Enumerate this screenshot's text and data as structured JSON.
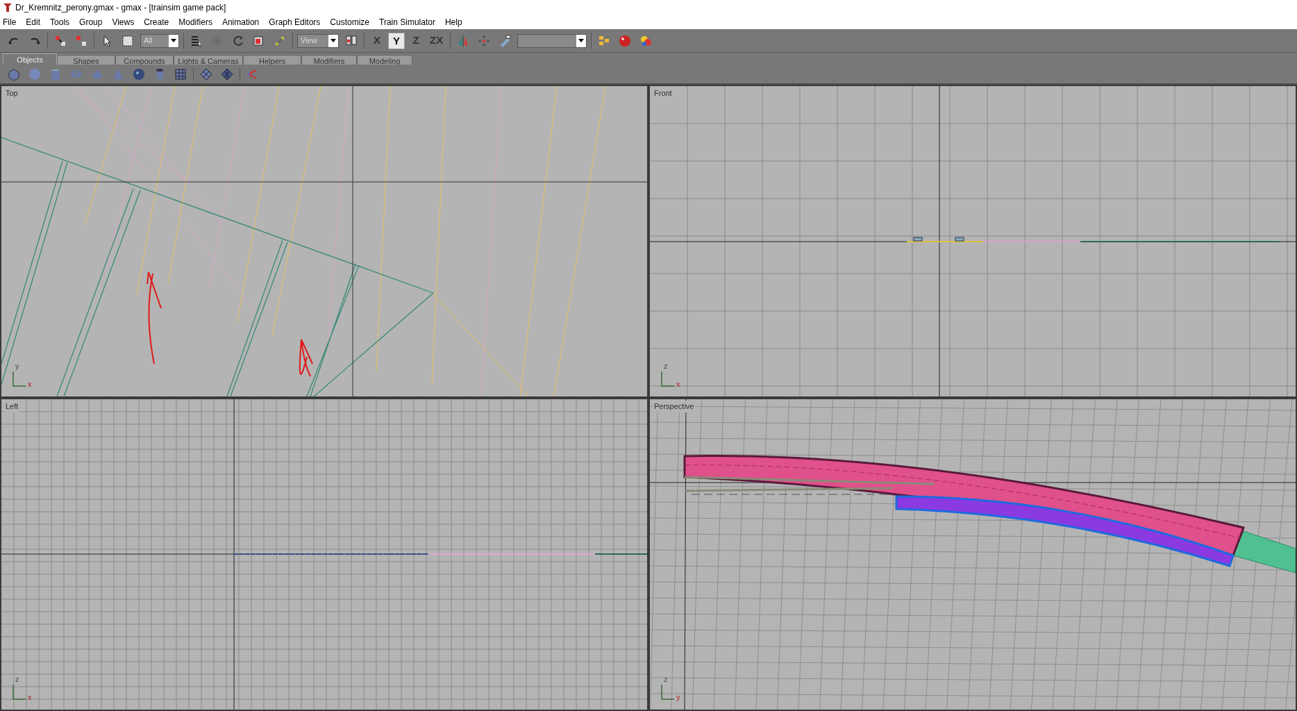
{
  "window": {
    "title": "Dr_Kremnitz_perony.gmax - gmax - [trainsim game pack]"
  },
  "menu": [
    "File",
    "Edit",
    "Tools",
    "Group",
    "Views",
    "Create",
    "Modifiers",
    "Animation",
    "Graph Editors",
    "Customize",
    "Train Simulator",
    "Help"
  ],
  "toolbar": {
    "selection_filter": "All",
    "coordinate_system": "View",
    "axis_buttons": [
      {
        "label": "X",
        "selected": false
      },
      {
        "label": "Y",
        "selected": true
      },
      {
        "label": "Z",
        "selected": false
      },
      {
        "label": "ZX",
        "selected": false
      }
    ]
  },
  "create_tabs": [
    {
      "label": "Objects",
      "selected": true
    },
    {
      "label": "Shapes",
      "selected": false
    },
    {
      "label": "Compounds",
      "selected": false
    },
    {
      "label": "Lights & Cameras",
      "selected": false
    },
    {
      "label": "Helpers",
      "selected": false
    },
    {
      "label": "Modifiers",
      "selected": false
    },
    {
      "label": "Modeling",
      "selected": false
    }
  ],
  "viewports": [
    {
      "kind": "top",
      "label": "Top",
      "axis_vertical": "y",
      "axis_horizontal": "x"
    },
    {
      "kind": "front",
      "label": "Front",
      "axis_vertical": "z",
      "axis_horizontal": "x"
    },
    {
      "kind": "left",
      "label": "Left",
      "axis_vertical": "z",
      "axis_horizontal": "x"
    },
    {
      "kind": "perspective",
      "label": "Perspective",
      "axis_vertical": "z",
      "axis_horizontal": "y"
    }
  ]
}
